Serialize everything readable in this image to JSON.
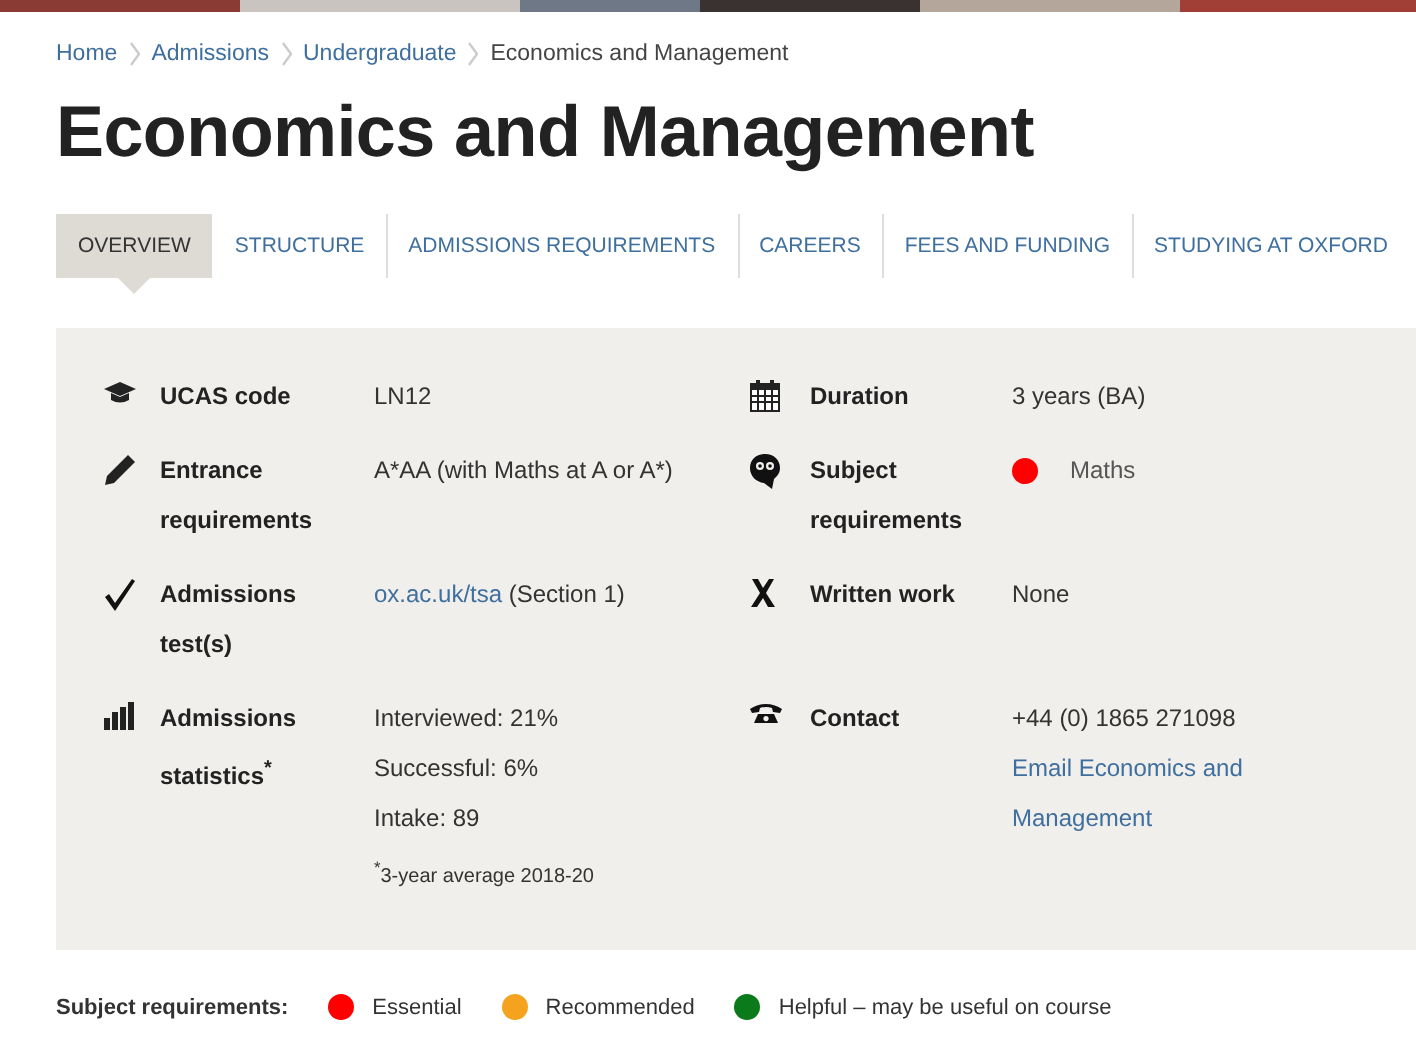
{
  "breadcrumb": [
    {
      "label": "Home",
      "kind": "link"
    },
    {
      "label": "Admissions",
      "kind": "link"
    },
    {
      "label": "Undergraduate",
      "kind": "link"
    },
    {
      "label": "Economics and Management",
      "kind": "current"
    }
  ],
  "title": "Economics and Management",
  "tabs": [
    {
      "label": "OVERVIEW",
      "selected": true
    },
    {
      "label": "STRUCTURE",
      "selected": false
    },
    {
      "label": "ADMISSIONS REQUIREMENTS",
      "selected": false
    },
    {
      "label": "CAREERS",
      "selected": false
    },
    {
      "label": "FEES AND FUNDING",
      "selected": false
    },
    {
      "label": "STUDYING AT OXFORD",
      "selected": false
    }
  ],
  "details": [
    {
      "left": {
        "label": "UCAS code",
        "lines": [
          {
            "kind": "text",
            "parts": [
              {
                "text": "LN12",
                "kind": "text"
              }
            ]
          }
        ]
      },
      "right": {
        "label": "Duration",
        "lines": [
          {
            "kind": "text",
            "parts": [
              {
                "text": "3 years (BA)",
                "kind": "text"
              }
            ]
          }
        ]
      }
    },
    {
      "left": {
        "label": "Entrance requirements",
        "lines": [
          {
            "kind": "text",
            "parts": [
              {
                "text": "A*AA (with Maths at A or A*)",
                "kind": "text"
              }
            ]
          }
        ]
      },
      "right": {
        "label": "Subject requirements",
        "lines": [
          {
            "kind": "subject",
            "color": "#ff0000",
            "parts": [
              {
                "text": "Maths",
                "kind": "text"
              }
            ]
          }
        ]
      }
    },
    {
      "left": {
        "label": "Admissions test(s)",
        "lines": [
          {
            "kind": "text",
            "parts": [
              {
                "text": "ox.ac.uk/tsa",
                "kind": "link"
              },
              {
                "text": " (Section 1)",
                "kind": "text"
              }
            ]
          }
        ]
      },
      "right": {
        "label": "Written work",
        "lines": [
          {
            "kind": "text",
            "parts": [
              {
                "text": "None",
                "kind": "text"
              }
            ]
          }
        ]
      }
    },
    {
      "left": {
        "label": "Admissions statistics$^{*}$",
        "lines": [
          {
            "kind": "text",
            "parts": [
              {
                "text": "Interviewed: 21%",
                "kind": "text"
              }
            ]
          },
          {
            "kind": "text",
            "parts": [
              {
                "text": "Successful: 6%",
                "kind": "text"
              }
            ]
          },
          {
            "kind": "text",
            "parts": [
              {
                "text": "Intake: 89",
                "kind": "text"
              }
            ]
          },
          {
            "kind": "note",
            "parts": [
              {
                "text": "$^{*}$3-year average 2018-20",
                "kind": "text"
              }
            ]
          }
        ]
      },
      "right": {
        "label": "Contact",
        "lines": [
          {
            "kind": "text",
            "parts": [
              {
                "text": "+44 (0) 1865 271098",
                "kind": "text"
              }
            ]
          },
          {
            "kind": "text",
            "parts": [
              {
                "text": "Email Economics and Management",
                "kind": "link"
              }
            ]
          }
        ]
      }
    }
  ],
  "legend": {
    "title": "Subject requirements:",
    "items": [
      {
        "label": "Essential",
        "color": "#ff0000"
      },
      {
        "label": "Recommended",
        "color": "#f5a31e"
      },
      {
        "label": "Helpful – may be useful on course",
        "color": "#0a7a1a"
      }
    ]
  }
}
